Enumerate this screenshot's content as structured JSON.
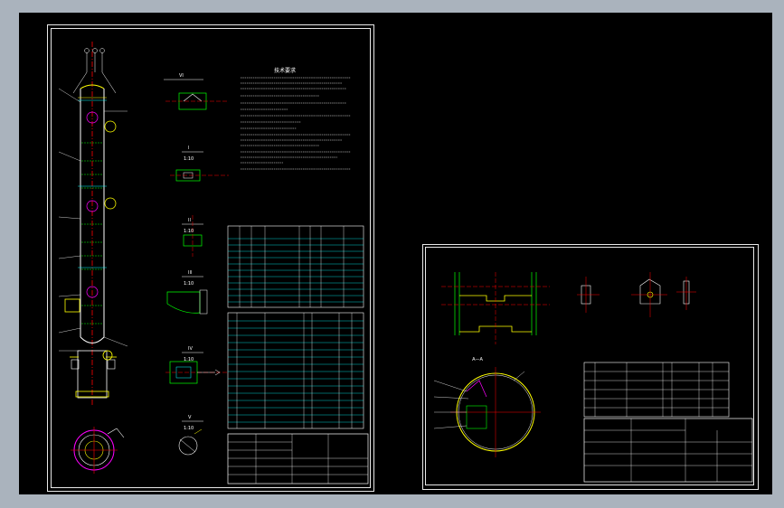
{
  "sheets": [
    {
      "id": "sheet-main",
      "notes_heading": "技术要求",
      "details": [
        "I",
        "II",
        "III",
        "IV",
        "V",
        "VI"
      ],
      "detail_scale": "1:10"
    },
    {
      "id": "sheet-detail",
      "section_label": "A—A"
    }
  ],
  "colors": {
    "background": "#000000",
    "outside": "#aab3bd",
    "border": "#e8e8e8",
    "centerline": "#ff0000",
    "vessel": "#00ff00",
    "table": "#00ffff",
    "dimension": "#ffff00",
    "leader": "#ff00ff"
  }
}
